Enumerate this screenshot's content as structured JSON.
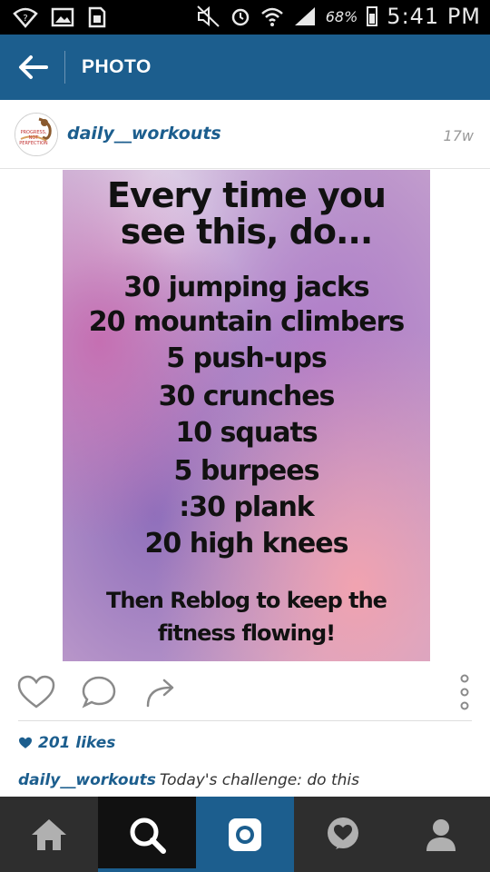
{
  "status_bar": {
    "battery_pct": "68%",
    "time": "5:41 PM",
    "icons": [
      "wifi-alert-icon",
      "image-icon",
      "storage-icon",
      "mute-icon",
      "alarm-icon",
      "wifi-icon",
      "signal-icon",
      "battery-icon"
    ]
  },
  "appbar": {
    "title": "PHOTO",
    "back_icon": "arrow-left-icon",
    "color": "#1c5e8e"
  },
  "post": {
    "username": "daily__workouts",
    "age": "17w",
    "avatar_text": "PROGRESS, NOT PERFECTION",
    "photo": {
      "lines": [
        "Every time you",
        "see this, do...",
        "30 jumping jacks",
        "20 mountain climbers",
        "5 push-ups",
        "30 crunches",
        "10 squats",
        "5 burpees",
        ":30 plank",
        "20 high knees",
        "Then Reblog to keep the",
        "fitness flowing!"
      ]
    },
    "actions": [
      "heart-icon",
      "comment-icon",
      "share-icon",
      "more-icon"
    ],
    "likes": "201 likes",
    "caption_user": "daily__workouts",
    "caption_text": "Today's challenge: do this"
  },
  "nav": {
    "items": [
      "home-icon",
      "search-icon",
      "camera-icon",
      "activity-icon",
      "profile-icon"
    ],
    "active": "search-icon"
  }
}
